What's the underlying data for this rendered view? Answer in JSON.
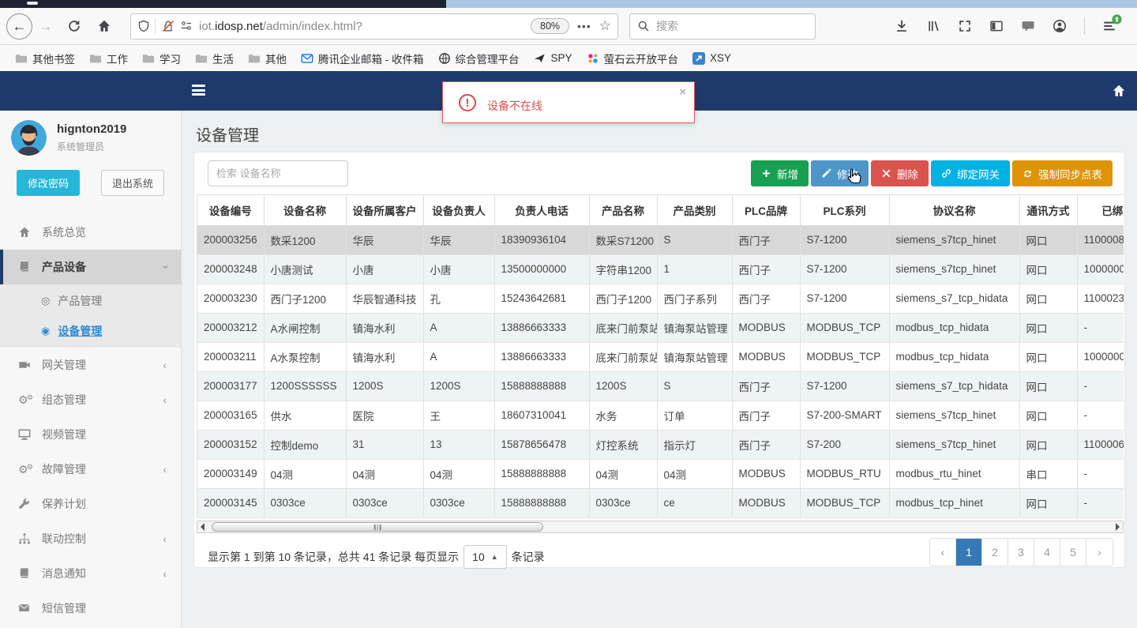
{
  "browser": {
    "toolbar": {
      "url_prefix": "iot.",
      "url_domain": "idosp.net",
      "url_path": "/admin/index.html?",
      "zoom_badge": "80%",
      "page_actions": "•••",
      "bookmark_star": "☆",
      "back": "←",
      "forward": "→",
      "search_placeholder": "搜索",
      "icons": [
        "shield-icon",
        "insecure-lock-icon",
        "permissions-icon",
        "download-icon",
        "library-icon",
        "screenshot-icon",
        "sidebar-toggle-icon",
        "chat-icon",
        "account-icon",
        "menu-icon",
        "update-badge-icon"
      ]
    },
    "bookmarks": [
      {
        "label": "其他书签",
        "icon": "folder-icon"
      },
      {
        "label": "工作",
        "icon": "folder-icon"
      },
      {
        "label": "学习",
        "icon": "folder-icon"
      },
      {
        "label": "生活",
        "icon": "folder-icon"
      },
      {
        "label": "其他",
        "icon": "folder-icon"
      },
      {
        "label": "腾讯企业邮箱 - 收件箱",
        "icon": "tencent-mail-icon"
      },
      {
        "label": "综合管理平台",
        "icon": "globe-icon"
      },
      {
        "label": "SPY",
        "icon": "spy-icon"
      },
      {
        "label": "萤石云开放平台",
        "icon": "ys7-dots-icon"
      },
      {
        "label": "XSY",
        "icon": "xsy-icon"
      }
    ]
  },
  "navbar": {
    "menu_icon": "hamburger-icon",
    "home_icon": "home-icon"
  },
  "alert": {
    "message": "设备不在线",
    "close": "×",
    "color": "#e04f4f"
  },
  "sidebar": {
    "user": {
      "name": "hignton2019",
      "role": "系统管理员"
    },
    "change_password": "修改密码",
    "logout": "退出系统",
    "menu": [
      {
        "label": "系统总览",
        "icon": "home-icon",
        "state": "none"
      },
      {
        "label": "产品设备",
        "icon": "book-icon",
        "state": "expanded",
        "children": [
          {
            "label": "产品管理",
            "active": false
          },
          {
            "label": "设备管理",
            "active": true
          }
        ]
      },
      {
        "label": "网关管理",
        "icon": "video-icon",
        "state": "collapsed"
      },
      {
        "label": "组态管理",
        "icon": "gears-icon",
        "state": "collapsed"
      },
      {
        "label": "视频管理",
        "icon": "monitor-icon",
        "state": "none"
      },
      {
        "label": "故障管理",
        "icon": "gears-icon",
        "state": "collapsed"
      },
      {
        "label": "保养计划",
        "icon": "wrench-icon",
        "state": "none"
      },
      {
        "label": "联动控制",
        "icon": "sitemap-icon",
        "state": "collapsed"
      },
      {
        "label": "消息通知",
        "icon": "book-icon",
        "state": "collapsed"
      },
      {
        "label": "短信管理",
        "icon": "envelope-icon",
        "state": "none"
      }
    ]
  },
  "main": {
    "title": "设备管理",
    "search_placeholder": "检索 设备名称",
    "buttons": [
      {
        "label": "新增",
        "icon": "plus-icon",
        "color": "#18a052"
      },
      {
        "label": "修改",
        "icon": "pencil-icon",
        "color": "#4e95c8"
      },
      {
        "label": "删除",
        "icon": "x-icon",
        "color": "#d9534f"
      },
      {
        "label": "绑定网关",
        "icon": "link-icon",
        "color": "#00b2e3"
      },
      {
        "label": "强制同步点表",
        "icon": "sync-icon",
        "color": "#dd9405"
      }
    ],
    "table": {
      "columns": [
        "设备编号",
        "设备名称",
        "设备所属客户",
        "设备负责人",
        "负责人电话",
        "产品名称",
        "产品类别",
        "PLC品牌",
        "PLC系列",
        "协议名称",
        "通讯方式",
        "已绑定网关"
      ],
      "rows": [
        [
          "200003256",
          "数采1200",
          "华辰",
          "华辰",
          "18390936104",
          "数采S71200",
          "S",
          "西门子",
          "S7-1200",
          "siemens_s7tcp_hinet",
          "网口",
          "1100008"
        ],
        [
          "200003248",
          "小唐测试",
          "小唐",
          "小唐",
          "13500000000",
          "字符串1200",
          "1",
          "西门子",
          "S7-1200",
          "siemens_s7tcp_hinet",
          "网口",
          "1000000"
        ],
        [
          "200003230",
          "西门子1200",
          "华辰智通科技",
          "孔",
          "15243642681",
          "西门子1200",
          "西门子系列",
          "西门子",
          "S7-1200",
          "siemens_s7_tcp_hidata",
          "网口",
          "1100023"
        ],
        [
          "200003212",
          "A水闸控制",
          "镇海水利",
          "A",
          "13886663333",
          "底来门前泵站",
          "镇海泵站管理",
          "MODBUS",
          "MODBUS_TCP",
          "modbus_tcp_hidata",
          "网口",
          "-"
        ],
        [
          "200003211",
          "A水泵控制",
          "镇海水利",
          "A",
          "13886663333",
          "底来门前泵站",
          "镇海泵站管理",
          "MODBUS",
          "MODBUS_TCP",
          "modbus_tcp_hidata",
          "网口",
          "1000000"
        ],
        [
          "200003177",
          "1200SSSSSS",
          "1200S",
          "1200S",
          "15888888888",
          "1200S",
          "S",
          "西门子",
          "S7-1200",
          "siemens_s7_tcp_hidata",
          "网口",
          "-"
        ],
        [
          "200003165",
          "供水",
          "医院",
          "王",
          "18607310041",
          "水务",
          "订单",
          "西门子",
          "S7-200-SMART",
          "siemens_s7tcp_hinet",
          "网口",
          "-"
        ],
        [
          "200003152",
          "控制demo",
          "31",
          "13",
          "15878656478",
          "灯控系统",
          "指示灯",
          "西门子",
          "S7-200",
          "siemens_s7tcp_hinet",
          "网口",
          "1100006"
        ],
        [
          "200003149",
          "04测",
          "04测",
          "04测",
          "15888888888",
          "04测",
          "04测",
          "MODBUS",
          "MODBUS_RTU",
          "modbus_rtu_hinet",
          "串口",
          "-"
        ],
        [
          "200003145",
          "0303ce",
          "0303ce",
          "0303ce",
          "15888888888",
          "0303ce",
          "ce",
          "MODBUS",
          "MODBUS_TCP",
          "modbus_tcp_hinet",
          "网口",
          "-"
        ]
      ],
      "selected_row": 0
    },
    "pagination": {
      "info": "显示第 1 到第 10 条记录，总共 41 条记录 每页显示",
      "page_size": "10",
      "info_suffix": "条记录",
      "prev_label": "‹",
      "next_label": "›",
      "pages": [
        "1",
        "2",
        "3",
        "4",
        "5"
      ],
      "active_page": "1"
    }
  },
  "colors": {
    "navbar": "#1e3a6d",
    "active_page": "#337ab7",
    "active_link": "#2a8bd8",
    "alert_red": "#e04f4f"
  }
}
